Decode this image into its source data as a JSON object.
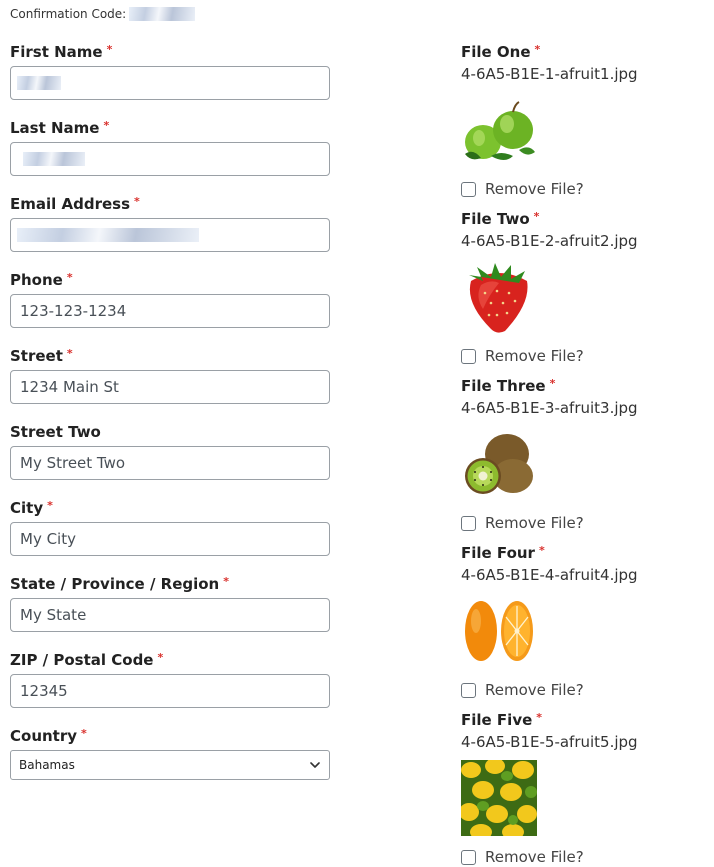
{
  "confirmation": {
    "label": "Confirmation Code:"
  },
  "required_marker": "*",
  "form": {
    "first_name": {
      "label": "First Name",
      "value": ""
    },
    "last_name": {
      "label": "Last Name",
      "value": ""
    },
    "email": {
      "label": "Email Address",
      "value": ""
    },
    "phone": {
      "label": "Phone",
      "value": "123-123-1234"
    },
    "street": {
      "label": "Street",
      "value": "1234 Main St"
    },
    "street_two": {
      "label": "Street Two",
      "value": "My Street Two"
    },
    "city": {
      "label": "City",
      "value": "My City"
    },
    "state": {
      "label": "State / Province / Region",
      "value": "My State"
    },
    "zip": {
      "label": "ZIP / Postal Code",
      "value": "12345"
    },
    "country": {
      "label": "Country",
      "value": "Bahamas"
    }
  },
  "files": [
    {
      "label": "File One",
      "filename": "4-6A5-B1E-1-afruit1.jpg",
      "remove_label": "Remove File?",
      "image": "green-apples"
    },
    {
      "label": "File Two",
      "filename": "4-6A5-B1E-2-afruit2.jpg",
      "remove_label": "Remove File?",
      "image": "strawberry"
    },
    {
      "label": "File Three",
      "filename": "4-6A5-B1E-3-afruit3.jpg",
      "remove_label": "Remove File?",
      "image": "kiwi"
    },
    {
      "label": "File Four",
      "filename": "4-6A5-B1E-4-afruit4.jpg",
      "remove_label": "Remove File?",
      "image": "orange"
    },
    {
      "label": "File Five",
      "filename": "4-6A5-B1E-5-afruit5.jpg",
      "remove_label": "Remove File?",
      "image": "lemons-limes"
    }
  ],
  "colors": {
    "required": "#d9312d",
    "input_border": "#9aa0a6",
    "text": "#212529"
  }
}
